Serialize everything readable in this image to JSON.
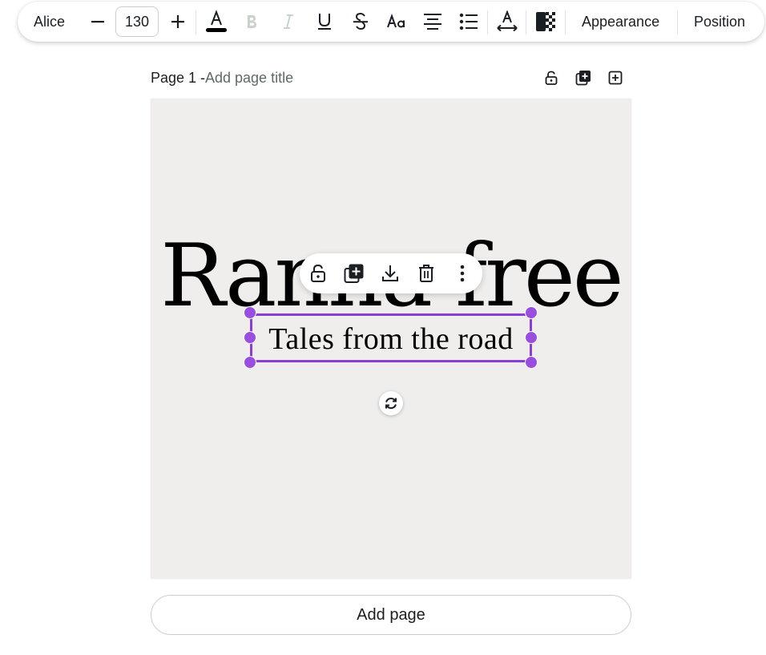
{
  "toolbar": {
    "font_name": "Alice",
    "font_size": "130",
    "icons": [
      "minus-icon",
      "plus-icon",
      "text-color-icon",
      "bold-icon",
      "italic-icon",
      "underline-icon",
      "strikethrough-icon",
      "letter-case-icon",
      "align-center-icon",
      "list-icon",
      "spacing-icon",
      "transparency-icon"
    ],
    "text_color": "#000000",
    "appearance_label": "Appearance",
    "position_label": "Position"
  },
  "page": {
    "label": "Page 1 -",
    "title_placeholder": "Add page title",
    "header_icons": [
      "lock-icon",
      "duplicate-page-icon",
      "add-page-icon"
    ]
  },
  "canvas": {
    "background": "#efeeec",
    "heading_text": "Ranna free",
    "subtitle_text": "Tales from the road",
    "selection_color": "#8b3dd8",
    "context_icons": [
      "lock-icon",
      "duplicate-icon",
      "download-icon",
      "trash-icon",
      "more-icon"
    ],
    "rotate_icon": "rotate-icon"
  },
  "add_page_label": "Add page"
}
